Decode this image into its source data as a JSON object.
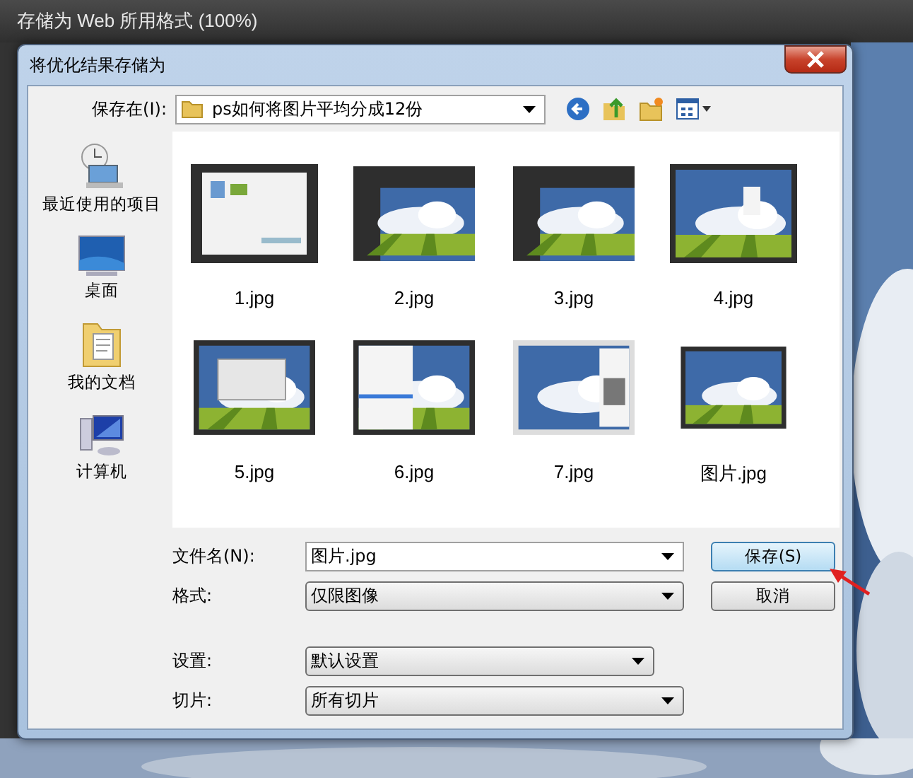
{
  "app_window": {
    "title": "存储为 Web 所用格式 (100%)"
  },
  "dialog": {
    "title": "将优化结果存储为",
    "save_in": {
      "label": "保存在(I):",
      "value": "ps如何将图片平均分成12份"
    },
    "places": [
      {
        "label": "最近使用的项目",
        "kind": "recent"
      },
      {
        "label": "桌面",
        "kind": "desktop"
      },
      {
        "label": "我的文档",
        "kind": "documents"
      },
      {
        "label": "计算机",
        "kind": "computer"
      }
    ],
    "files": [
      {
        "name": "1.jpg",
        "kind": "picture"
      },
      {
        "name": "2.jpg",
        "kind": "picture"
      },
      {
        "name": "3.jpg",
        "kind": "picture"
      },
      {
        "name": "4.jpg",
        "kind": "picture"
      },
      {
        "name": "5.jpg",
        "kind": "picture"
      },
      {
        "name": "6.jpg",
        "kind": "picture"
      },
      {
        "name": "7.jpg",
        "kind": "picture"
      },
      {
        "name": "图片.jpg",
        "kind": "picture"
      }
    ],
    "fields": [
      {
        "label": "文件名(N):",
        "value": "图片.jpg",
        "kind": "combo"
      },
      {
        "label": "格式:",
        "value": "仅限图像",
        "kind": "select"
      },
      {
        "label": "设置:",
        "value": "默认设置",
        "kind": "select",
        "gap": true
      },
      {
        "label": "切片:",
        "value": "所有切片",
        "kind": "select"
      }
    ],
    "buttons": [
      {
        "label": "保存(S)",
        "default": true
      },
      {
        "label": "取消",
        "default": false
      }
    ]
  }
}
